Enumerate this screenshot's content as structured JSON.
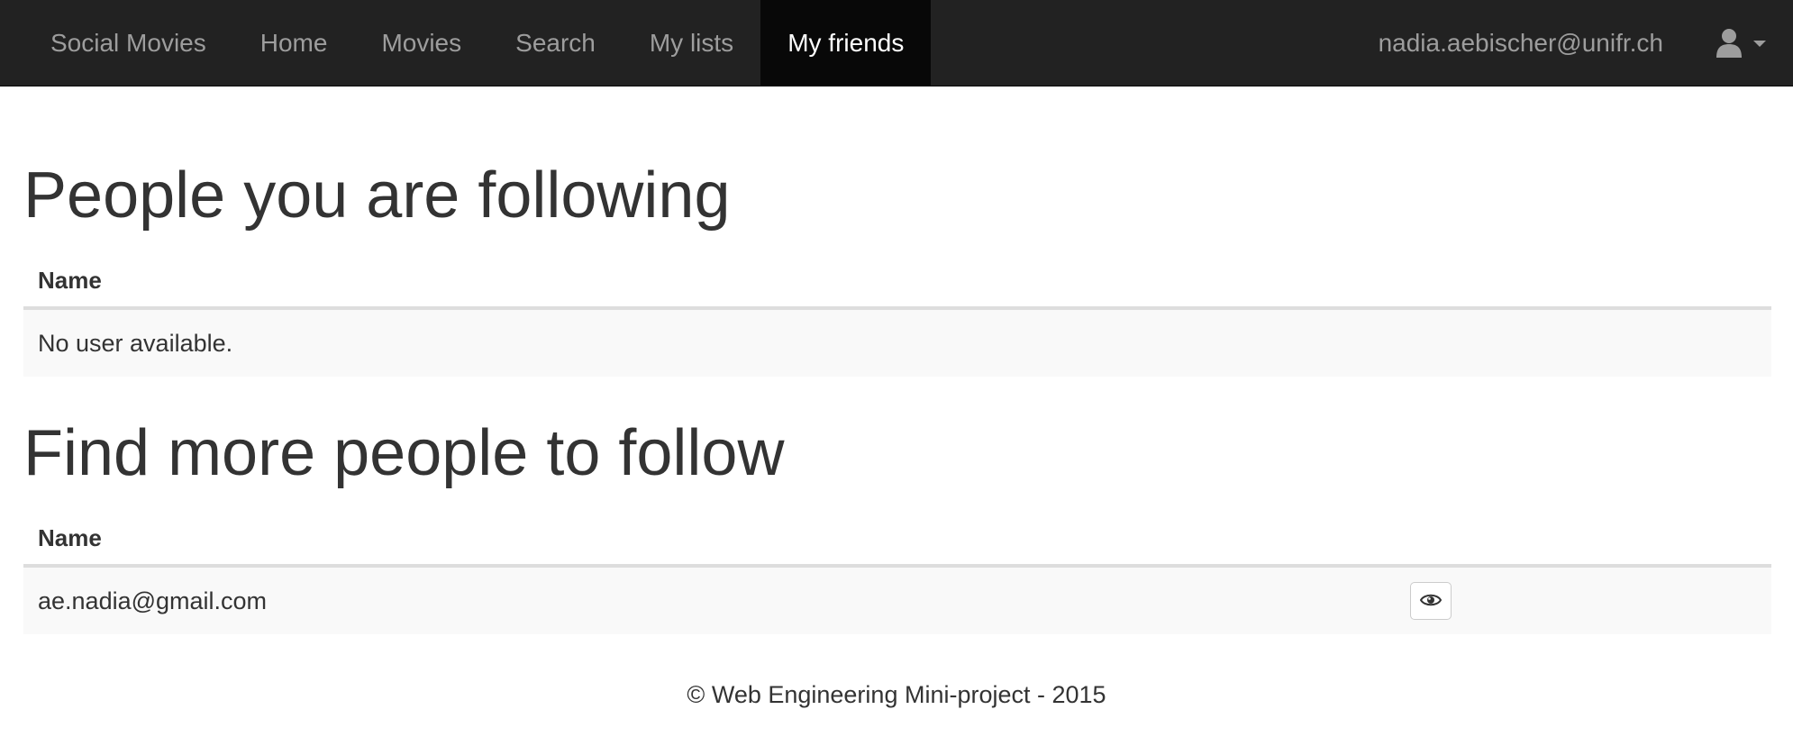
{
  "nav": {
    "brand": "Social Movies",
    "links": [
      {
        "label": "Home"
      },
      {
        "label": "Movies"
      },
      {
        "label": "Search"
      },
      {
        "label": "My lists"
      },
      {
        "label": "My friends",
        "active": true
      }
    ],
    "user_email": "nadia.aebischer@unifr.ch",
    "user_icon": "user-icon",
    "dropdown_icon": "caret-down-icon"
  },
  "following": {
    "heading": "People you are following",
    "column_header": "Name",
    "empty_message": "No user available."
  },
  "find": {
    "heading": "Find more people to follow",
    "column_header": "Name",
    "rows": [
      {
        "name": "ae.nadia@gmail.com",
        "action_icon": "eye-icon"
      }
    ]
  },
  "footer": {
    "text": "© Web Engineering Mini-project - 2015"
  },
  "colors": {
    "navbar_bg": "#222222",
    "navbar_active_bg": "#080808",
    "navbar_text": "#9d9d9d",
    "text": "#333333",
    "row_bg": "#f9f9f9"
  }
}
